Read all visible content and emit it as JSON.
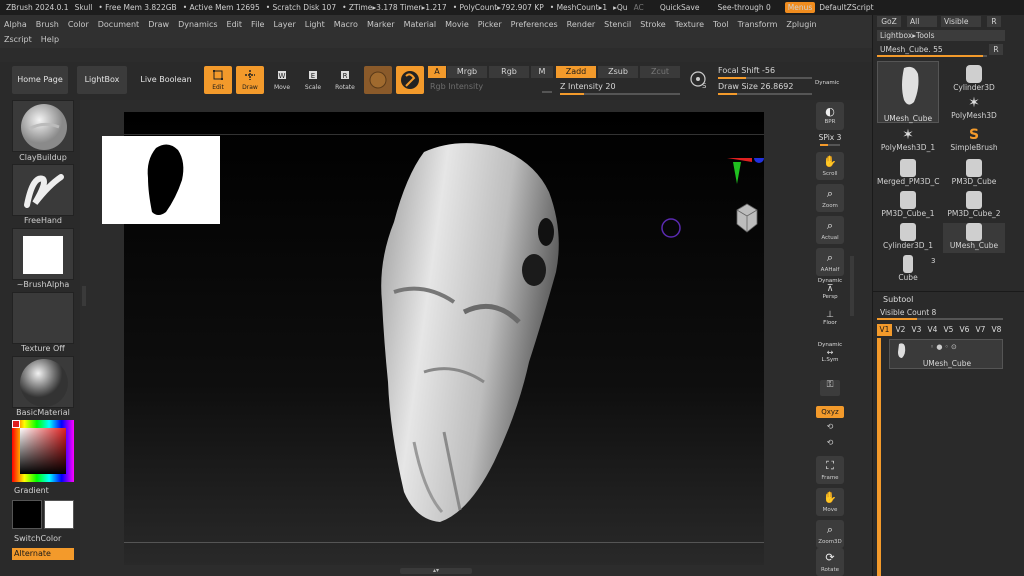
{
  "titlebar": {
    "app": "ZBrush 2024.0.1",
    "doc": "Skull",
    "free_mem": "• Free Mem 3.822GB",
    "active_mem": "• Active Mem 12695",
    "scratch": "• Scratch Disk 107",
    "ztime": "• ZTime▸3.178 Timer▸1.217",
    "polycount": "• PolyCount▸792.907 KP",
    "meshcount": "• MeshCount▸1",
    "qu": "▸Qu",
    "ac": "AC",
    "quicksave": "QuickSave",
    "seethrough": "See-through",
    "seethrough_val": "0",
    "menus": "Menus",
    "defaultzscript": "DefaultZScript"
  },
  "menubar": {
    "row1": [
      "Alpha",
      "Brush",
      "Color",
      "Document",
      "Draw",
      "Dynamics",
      "Edit",
      "File",
      "Layer",
      "Light",
      "Macro",
      "Marker",
      "Material",
      "Movie",
      "Picker",
      "Preferences",
      "Render",
      "Stencil",
      "Stroke",
      "Texture",
      "Tool",
      "Transform",
      "Zplugin"
    ],
    "row2": [
      "Zscript",
      "Help"
    ]
  },
  "toolbar": {
    "home": "Home Page",
    "lightbox": "LightBox",
    "liveboolean": "Live Boolean",
    "edit": "Edit",
    "draw": "Draw",
    "move": "Move",
    "scale": "Scale",
    "rotate": "Rotate",
    "a": "A",
    "mrgb": "Mrgb",
    "rgb": "Rgb",
    "m": "M",
    "zadd": "Zadd",
    "zsub": "Zsub",
    "zcut": "Zcut",
    "rgb_intensity": "Rgb Intensity",
    "z_intensity": "Z Intensity 20",
    "z_intensity_level": 0.2,
    "focal_shift": "Focal Shift -56",
    "draw_size": "Draw Size 26.8692",
    "dynamic": "Dynamic",
    "s": "S"
  },
  "leftshelf": {
    "brush": "ClayBuildup",
    "stroke": "FreeHand",
    "alpha": "~BrushAlpha",
    "texture": "Texture Off",
    "material": "BasicMaterial",
    "gradient": "Gradient",
    "switchcolor": "SwitchColor",
    "alternate": "Alternate"
  },
  "rightshelf": {
    "bpr": "BPR",
    "spix": "SPix 3",
    "scroll": "Scroll",
    "zoom": "Zoom",
    "actual": "Actual",
    "aahalf": "AAHalf",
    "dynamic": "Dynamic",
    "persp": "Persp",
    "floor": "Floor",
    "dynamic2": "Dynamic",
    "lsym": "L.Sym",
    "qxyz": "Qxyz",
    "frame": "Frame",
    "move": "Move",
    "zoom3d": "Zoom3D",
    "rotate": "Rotate"
  },
  "rpanel": {
    "goz": "GoZ",
    "all": "All",
    "visible": "Visible",
    "r": "R",
    "lightbox_tools": "Lightbox▸Tools",
    "umesh_cube": "UMesh_Cube. 55",
    "r2": "R",
    "tools": [
      "UMesh_Cube",
      "Cylinder3D",
      "PolyMesh3D",
      "PolyMesh3D_1",
      "SimpleBrush",
      "Merged_PM3D_C",
      "PM3D_Cube",
      "PM3D_Cube_1",
      "PM3D_Cube_2",
      "Cylinder3D_1",
      "UMesh_Cube",
      "Cube"
    ],
    "cube_count": "3",
    "subtool": "Subtool",
    "visible_count": "Visible Count 8",
    "versions": [
      "V1",
      "V2",
      "V3",
      "V4",
      "V5",
      "V6",
      "V7",
      "V8"
    ],
    "subtool_item": "UMesh_Cube"
  },
  "colors": {
    "accent": "#f39a2b",
    "panel": "#2a2a2a",
    "viewport": "#000000"
  }
}
